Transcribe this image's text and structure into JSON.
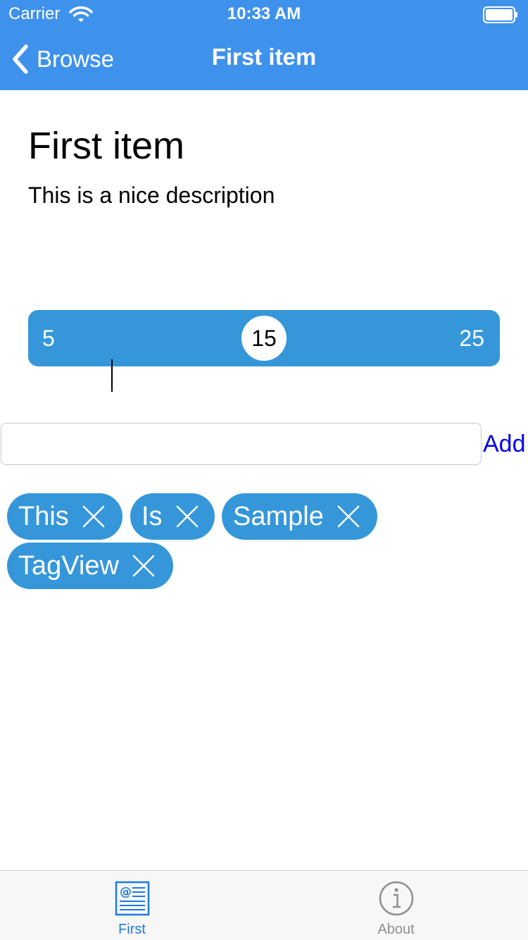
{
  "status_bar": {
    "carrier": "Carrier",
    "time": "10:33 AM"
  },
  "nav": {
    "back_label": "Browse",
    "title": "First item"
  },
  "item": {
    "title": "First item",
    "description": "This is a nice description"
  },
  "slider": {
    "min": "5",
    "value": "15",
    "max": "25"
  },
  "tag_input": {
    "value": "",
    "placeholder": "",
    "add_label": "Add"
  },
  "tags": [
    {
      "label": "This"
    },
    {
      "label": "Is"
    },
    {
      "label": "Sample"
    },
    {
      "label": "TagView"
    }
  ],
  "tab_bar": {
    "tabs": [
      {
        "label": "First",
        "icon": "news-icon",
        "selected": true
      },
      {
        "label": "About",
        "icon": "info-icon",
        "selected": false
      }
    ]
  },
  "colors": {
    "nav_background": "#3f92ec",
    "accent": "#3597da",
    "link": "#0000ee",
    "tab_selected": "#1e7ae5",
    "tab_unselected": "#8e8e8e"
  }
}
